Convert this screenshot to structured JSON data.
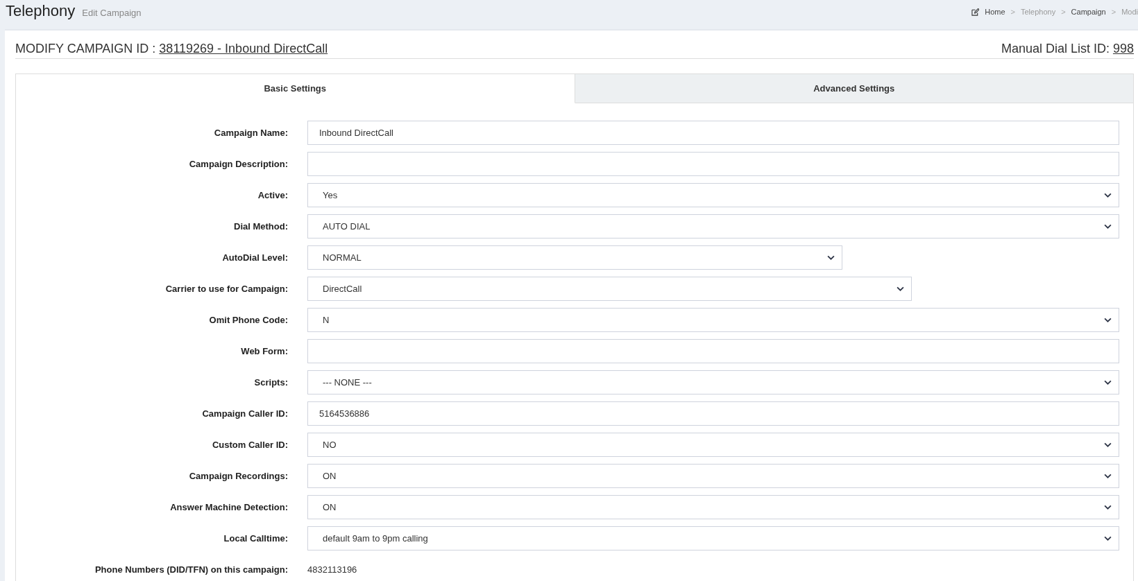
{
  "header": {
    "title": "Telephony",
    "subtitle": "Edit Campaign"
  },
  "breadcrumb": [
    {
      "label": "Home",
      "emphasized": true
    },
    {
      "label": "Telephony",
      "emphasized": false
    },
    {
      "label": "Campaign",
      "emphasized": true
    },
    {
      "label": "Modi",
      "emphasized": false
    }
  ],
  "breadcrumb_separator": ">",
  "heading": {
    "prefix": "MODIFY CAMPAIGN ID :",
    "link": "38119269 - Inbound DirectCall",
    "list_label": "Manual Dial List ID:",
    "list_link": "998"
  },
  "tabs": [
    {
      "label": "Basic Settings",
      "selected": true
    },
    {
      "label": "Advanced Settings",
      "selected": false
    }
  ],
  "fields": [
    {
      "label": "Campaign Name:",
      "kind": "text",
      "value": "Inbound DirectCall"
    },
    {
      "label": "Campaign Description:",
      "kind": "text"
    },
    {
      "label": "Active:",
      "kind": "select",
      "value": "Yes"
    },
    {
      "label": "Dial Method:",
      "kind": "select",
      "value": "AUTO DIAL"
    },
    {
      "label": "AutoDial Level:",
      "kind": "select",
      "value": "NORMAL"
    },
    {
      "label": "Carrier to use for Campaign:",
      "kind": "select",
      "value": "DirectCall"
    },
    {
      "label": "Omit Phone Code:",
      "kind": "select",
      "value": "N"
    },
    {
      "label": "Web Form:",
      "kind": "text"
    },
    {
      "label": "Scripts:",
      "kind": "select",
      "value": "--- NONE ---"
    },
    {
      "label": "Campaign Caller ID:",
      "kind": "text",
      "value": "5164536886"
    },
    {
      "label": "Custom Caller ID:",
      "kind": "select",
      "value": "NO"
    },
    {
      "label": "Campaign Recordings:",
      "kind": "select",
      "value": "ON"
    },
    {
      "label": "Answer Machine Detection:",
      "kind": "select",
      "value": "ON"
    },
    {
      "label": "Local Calltime:",
      "kind": "select",
      "value": "default 9am to 9pm calling"
    },
    {
      "label": "Phone Numbers (DID/TFN) on this campaign:",
      "kind": "static",
      "value": "4832113196"
    }
  ]
}
